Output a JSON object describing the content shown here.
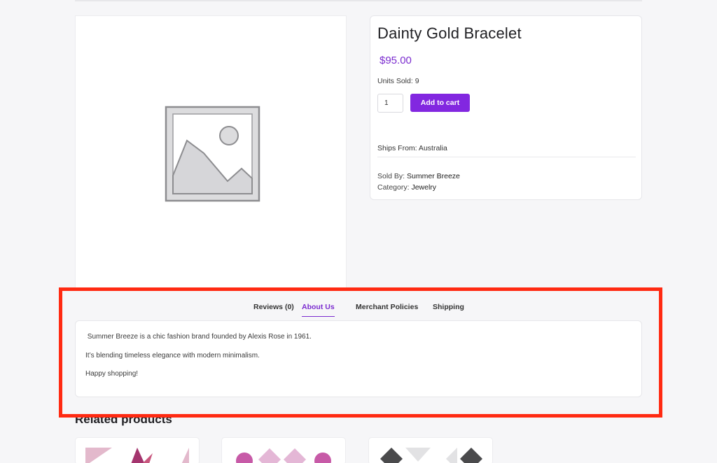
{
  "product": {
    "title": "Dainty Gold Bracelet",
    "price": "$95.00",
    "units_sold": "Units Sold: 9",
    "quantity": "1",
    "add_to_cart_label": "Add to cart",
    "ships_from": "Ships From: Australia",
    "sold_by_label": "Sold By:",
    "sold_by_value": "Summer Breeze",
    "category_label": "Category:",
    "category_value": "Jewelry",
    "image_icon": "image-placeholder-icon"
  },
  "tabs": [
    {
      "label": "Reviews (0)",
      "active": false
    },
    {
      "label": "About Us",
      "active": true
    },
    {
      "label": "Merchant Policies",
      "active": false
    },
    {
      "label": "Shipping",
      "active": false
    }
  ],
  "about_us": {
    "line1": " Summer Breeze is a chic fashion brand founded by Alexis Rose in 1961.",
    "line2": "It’s blending timeless elegance with modern minimalism.",
    "line3": "Happy shopping!"
  },
  "related": {
    "title": "Related products"
  },
  "colors": {
    "accent": "#7b2ccf",
    "button": "#8227e0",
    "highlight": "#ff2a12"
  }
}
